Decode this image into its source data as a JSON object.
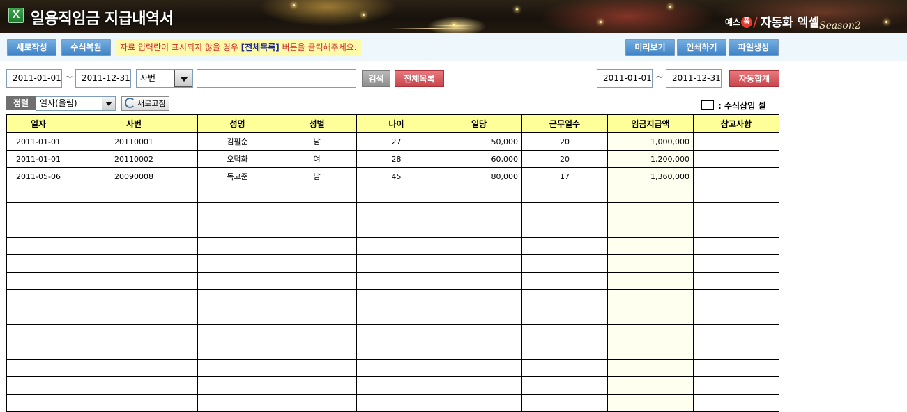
{
  "header": {
    "title": "일용직임금 지급내역서",
    "brand": {
      "yes": "예스",
      "mark": "폼",
      "name": "자동화 엑셀",
      "season": "Season2"
    }
  },
  "toolbar": {
    "new_label": "새로작성",
    "restore_label": "수식복원",
    "notice_pre": "자료 입력란이 표시되지  않을 경우 ",
    "notice_em": "[전체목록]",
    "notice_post": " 버튼을 클릭해주세요.",
    "preview_label": "미리보기",
    "print_label": "인쇄하기",
    "file_label": "파일생성"
  },
  "search": {
    "date_from": "2011-01-01",
    "tilde": "~",
    "date_to": "2011-12-31",
    "field_selected": "사번",
    "keyword": "",
    "search_label": "검색",
    "all_label": "전체목록",
    "sum_date_from": "2011-01-01",
    "sum_date_to": "2011-12-31",
    "autosum_label": "자동합계"
  },
  "sort": {
    "label": "정렬",
    "selected": "일자(올림)",
    "refresh_label": "새로고침",
    "legend_text": ": 수식삽입 셀"
  },
  "table": {
    "columns": [
      "일자",
      "사번",
      "성명",
      "성별",
      "나이",
      "일당",
      "근무일수",
      "임금지급액",
      "참고사항"
    ],
    "rows": [
      [
        "2011-01-01",
        "20110001",
        "김필순",
        "남",
        "27",
        "50,000",
        "20",
        "1,000,000",
        ""
      ],
      [
        "2011-01-01",
        "20110002",
        "오덕화",
        "여",
        "28",
        "60,000",
        "20",
        "1,200,000",
        ""
      ],
      [
        "2011-05-06",
        "20090008",
        "독고준",
        "남",
        "45",
        "80,000",
        "17",
        "1,360,000",
        ""
      ],
      [
        "",
        "",
        "",
        "",
        "",
        "",
        "",
        "",
        ""
      ],
      [
        "",
        "",
        "",
        "",
        "",
        "",
        "",
        "",
        ""
      ],
      [
        "",
        "",
        "",
        "",
        "",
        "",
        "",
        "",
        ""
      ],
      [
        "",
        "",
        "",
        "",
        "",
        "",
        "",
        "",
        ""
      ],
      [
        "",
        "",
        "",
        "",
        "",
        "",
        "",
        "",
        ""
      ],
      [
        "",
        "",
        "",
        "",
        "",
        "",
        "",
        "",
        ""
      ],
      [
        "",
        "",
        "",
        "",
        "",
        "",
        "",
        "",
        ""
      ],
      [
        "",
        "",
        "",
        "",
        "",
        "",
        "",
        "",
        ""
      ],
      [
        "",
        "",
        "",
        "",
        "",
        "",
        "",
        "",
        ""
      ],
      [
        "",
        "",
        "",
        "",
        "",
        "",
        "",
        "",
        ""
      ],
      [
        "",
        "",
        "",
        "",
        "",
        "",
        "",
        "",
        ""
      ],
      [
        "",
        "",
        "",
        "",
        "",
        "",
        "",
        "",
        ""
      ],
      [
        "",
        "",
        "",
        "",
        "",
        "",
        "",
        "",
        ""
      ]
    ]
  }
}
